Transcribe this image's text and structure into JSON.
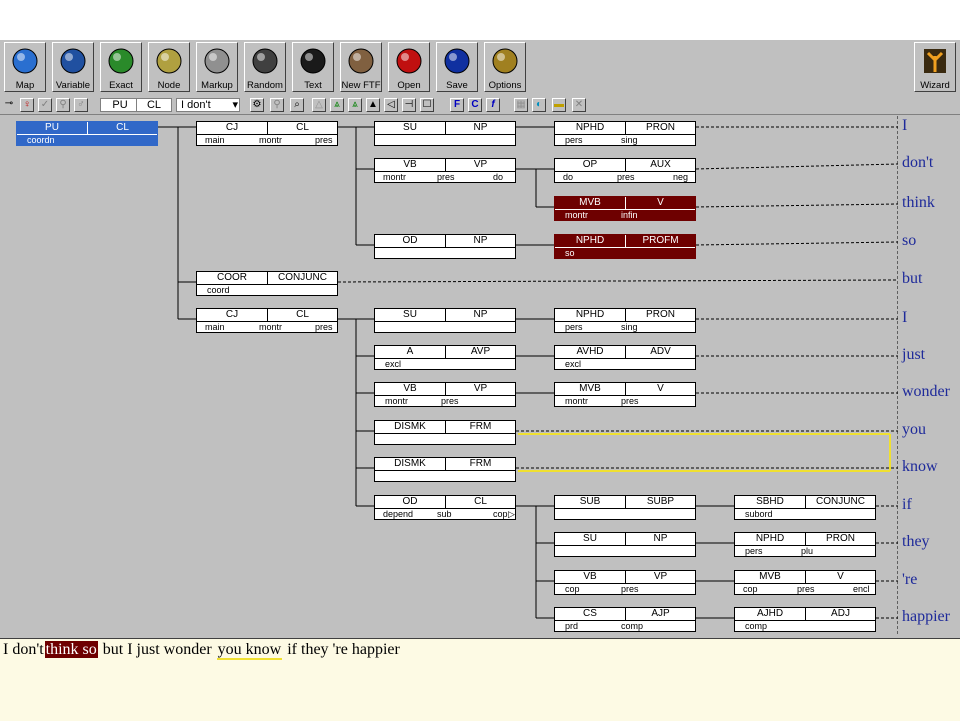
{
  "toolbar": {
    "buttons": [
      {
        "label": "Map",
        "icon": "globe-icon"
      },
      {
        "label": "Variable",
        "icon": "globe-network-icon"
      },
      {
        "label": "Exact",
        "icon": "tree-leaves-icon"
      },
      {
        "label": "Node",
        "icon": "flower-icon"
      },
      {
        "label": "Markup",
        "icon": "markup-icon"
      },
      {
        "label": "Random",
        "icon": "dice-icon"
      },
      {
        "label": "Text",
        "icon": "text-icon"
      },
      {
        "label": "New FTF",
        "icon": "tree-icon"
      },
      {
        "label": "Open",
        "icon": "open-folder-icon"
      },
      {
        "label": "Save",
        "icon": "save-disk-icon"
      },
      {
        "label": "Options",
        "icon": "options-icon"
      }
    ],
    "wizard_label": "Wizard"
  },
  "bar2": {
    "pu": "PU",
    "cl": "CL",
    "sentence_select": "I don't"
  },
  "nodes": [
    {
      "id": "pu",
      "f": "PU",
      "c": "CL",
      "s": [
        "coordn"
      ],
      "style": "sel"
    },
    {
      "id": "cj1",
      "f": "CJ",
      "c": "CL",
      "s": [
        "main",
        "montr",
        "pres"
      ]
    },
    {
      "id": "su1",
      "f": "SU",
      "c": "NP",
      "s": []
    },
    {
      "id": "nphd1",
      "f": "NPHD",
      "c": "PRON",
      "s": [
        "pers",
        "sing"
      ]
    },
    {
      "id": "vb1",
      "f": "VB",
      "c": "VP",
      "s": [
        "montr",
        "pres",
        "do"
      ]
    },
    {
      "id": "op1",
      "f": "OP",
      "c": "AUX",
      "s": [
        "do",
        "pres",
        "neg"
      ]
    },
    {
      "id": "mvb1",
      "f": "MVB",
      "c": "V",
      "s": [
        "montr",
        "infin"
      ],
      "style": "dark"
    },
    {
      "id": "od1",
      "f": "OD",
      "c": "NP",
      "s": []
    },
    {
      "id": "nphd2",
      "f": "NPHD",
      "c": "PROFM",
      "s": [
        "so"
      ],
      "style": "dark"
    },
    {
      "id": "coor",
      "f": "COOR",
      "c": "CONJUNC",
      "s": [
        "coord"
      ]
    },
    {
      "id": "cj2",
      "f": "CJ",
      "c": "CL",
      "s": [
        "main",
        "montr",
        "pres"
      ]
    },
    {
      "id": "su2",
      "f": "SU",
      "c": "NP",
      "s": []
    },
    {
      "id": "nphd3",
      "f": "NPHD",
      "c": "PRON",
      "s": [
        "pers",
        "sing"
      ]
    },
    {
      "id": "a1",
      "f": "A",
      "c": "AVP",
      "s": [
        "excl"
      ]
    },
    {
      "id": "avhd",
      "f": "AVHD",
      "c": "ADV",
      "s": [
        "excl"
      ]
    },
    {
      "id": "vb2",
      "f": "VB",
      "c": "VP",
      "s": [
        "montr",
        "pres"
      ]
    },
    {
      "id": "mvb2",
      "f": "MVB",
      "c": "V",
      "s": [
        "montr",
        "pres"
      ]
    },
    {
      "id": "dismk1",
      "f": "DISMK",
      "c": "FRM",
      "s": []
    },
    {
      "id": "dismk2",
      "f": "DISMK",
      "c": "FRM",
      "s": []
    },
    {
      "id": "od2",
      "f": "OD",
      "c": "CL",
      "s": [
        "depend",
        "sub",
        "cop"
      ]
    },
    {
      "id": "sub",
      "f": "SUB",
      "c": "SUBP",
      "s": []
    },
    {
      "id": "sbhd",
      "f": "SBHD",
      "c": "CONJUNC",
      "s": [
        "subord"
      ]
    },
    {
      "id": "su3",
      "f": "SU",
      "c": "NP",
      "s": []
    },
    {
      "id": "nphd4",
      "f": "NPHD",
      "c": "PRON",
      "s": [
        "pers",
        "plu"
      ]
    },
    {
      "id": "vb3",
      "f": "VB",
      "c": "VP",
      "s": [
        "cop",
        "pres"
      ]
    },
    {
      "id": "mvb3",
      "f": "MVB",
      "c": "V",
      "s": [
        "cop",
        "pres",
        "encl"
      ]
    },
    {
      "id": "cs",
      "f": "CS",
      "c": "AJP",
      "s": [
        "prd",
        "comp"
      ]
    },
    {
      "id": "ajhd",
      "f": "AJHD",
      "c": "ADJ",
      "s": [
        "comp"
      ]
    }
  ],
  "words": [
    "I",
    "don't",
    "think",
    "so",
    "but",
    "I",
    "just",
    "wonder",
    "you",
    "know",
    "if",
    "they",
    "'re",
    "happier"
  ],
  "sentence": [
    "I don't",
    "think so",
    "but I just wonder",
    "you know",
    "if they 're happier"
  ],
  "colors": {
    "selected": "#3168c8",
    "dark": "#6e0000",
    "word": "#1e2a9a",
    "yellow": "#f0e030"
  }
}
